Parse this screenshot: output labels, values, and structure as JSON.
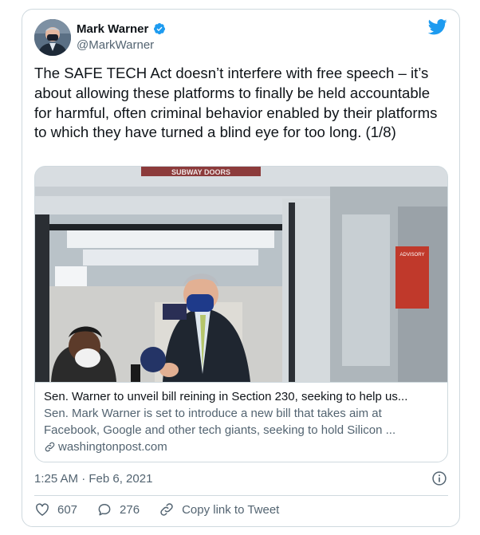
{
  "author": {
    "name": "Mark Warner",
    "handle": "@MarkWarner",
    "verified": true
  },
  "tweet": {
    "text": "The SAFE TECH Act doesn’t interfere with free speech – it’s about allowing these platforms to finally be held accountable for harmful, often criminal behavior enabled by their platforms to which they have turned a blind eye for too long. (1/8)",
    "timestamp": "1:25 AM · Feb 6, 2021"
  },
  "link_card": {
    "image_sign_text": "SUBWAY DOORS",
    "image_advisory_text": "ADVISORY",
    "title": "Sen. Warner to unveil bill reining in Section 230, seeking to help us...",
    "description": "Sen. Mark Warner is set to introduce a new bill that takes aim at Facebook, Google and other tech giants, seeking to hold Silicon ...",
    "domain": "washingtonpost.com"
  },
  "actions": {
    "likes": "607",
    "replies": "276",
    "copy_link_label": "Copy link to Tweet"
  },
  "colors": {
    "twitter_blue": "#1d9bf0",
    "text_primary": "#0f1419",
    "text_secondary": "#536471",
    "border": "#cfd9de"
  }
}
